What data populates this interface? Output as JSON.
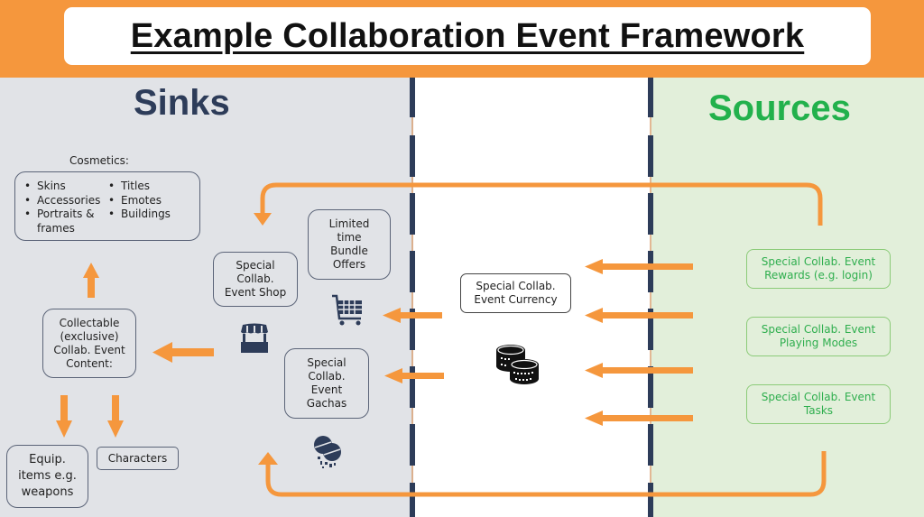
{
  "header": {
    "title": "Example Collaboration Event Framework"
  },
  "colors": {
    "header_bg": "#F5973D",
    "sinks_bg": "#E1E3E7",
    "sources_bg": "#E2EFDA",
    "arrow": "#F5973D",
    "sinks_title": "#2D3C59",
    "sources_title": "#22B14C",
    "divider": "#2D3C59"
  },
  "sinks": {
    "title": "Sinks",
    "cosmetics": {
      "heading": "Cosmetics:",
      "col1": [
        "Skins",
        "Accessories",
        "Portraits &",
        "frames"
      ],
      "col2": [
        "Titles",
        "Emotes",
        "Buildings"
      ]
    },
    "collectable": [
      "Collectable",
      "(exclusive)",
      "Collab. Event",
      "Content:"
    ],
    "equip": [
      "Equip.",
      "items e.g.",
      "weapons"
    ],
    "characters": "Characters",
    "shop": [
      "Special",
      "Collab.",
      "Event Shop"
    ],
    "bundles": [
      "Limited",
      "time",
      "Bundle",
      "Offers"
    ],
    "gachas": [
      "Special",
      "Collab.",
      "Event",
      "Gachas"
    ]
  },
  "currency": {
    "label": [
      "Special Collab.",
      "Event Currency"
    ]
  },
  "sources": {
    "title": "Sources",
    "items": [
      [
        "Special Collab. Event",
        "Rewards (e.g. login)"
      ],
      [
        "Special Collab. Event",
        "Playing Modes"
      ],
      [
        "Special Collab. Event",
        "Tasks"
      ]
    ]
  },
  "icons": {
    "shop": "shop-stall-icon",
    "cart": "shopping-cart-icon",
    "gacha": "gacha-capsule-icon",
    "coins": "coin-stack-icon"
  }
}
